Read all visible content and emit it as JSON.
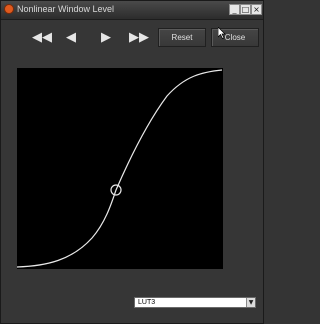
{
  "window": {
    "title": "Nonlinear Window Level",
    "minimize": "_",
    "maximize": "□",
    "close": "×"
  },
  "toolbar": {
    "first_icon": "◀◀",
    "prev_icon": "◀",
    "next_icon": "▶",
    "last_icon": "▶▶",
    "reset_label": "Reset",
    "close_label": "Close"
  },
  "lut_select": {
    "selected": "LUT3",
    "arrow": "▼"
  }
}
